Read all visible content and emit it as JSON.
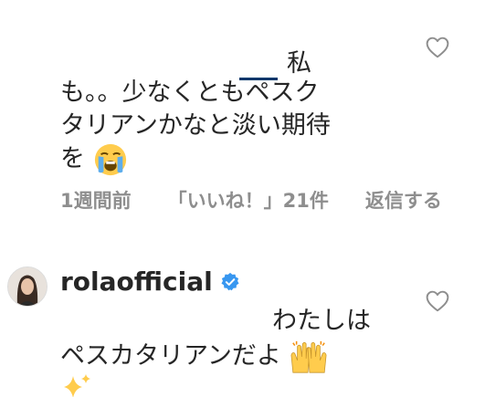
{
  "comment1": {
    "mention_tail": "私",
    "line1": "も。。少なくともペスク",
    "line2": "タリアンかなと淡い期待",
    "line3": "を",
    "emoji_name": "loudly-crying-face",
    "time": "1週間前",
    "likes": "「いいね！」21件",
    "reply": "返信する"
  },
  "comment2": {
    "username": "rolaofficial",
    "verified_icon": "verified-badge-icon",
    "line1": "わたしは",
    "line2": "ペスカタリアンだよ",
    "emoji1_name": "raising-hands",
    "emoji2_name": "sparkles"
  },
  "colors": {
    "text": "#262626",
    "meta": "#8e8e8e",
    "verified": "#3897f0",
    "mention_underline": "#00376b"
  }
}
